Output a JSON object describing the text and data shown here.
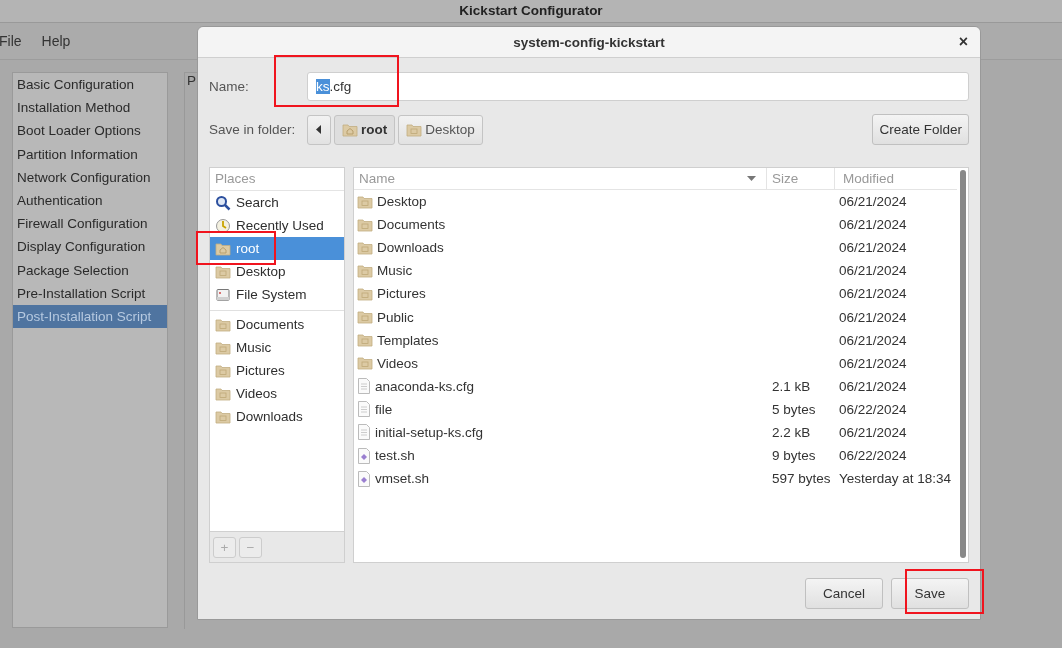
{
  "window": {
    "title": "Kickstart Configurator"
  },
  "menu": [
    "File",
    "Help"
  ],
  "sidebar": {
    "items": [
      {
        "label": "Basic Configuration",
        "selected": false
      },
      {
        "label": "Installation Method",
        "selected": false
      },
      {
        "label": "Boot Loader Options",
        "selected": false
      },
      {
        "label": "Partition Information",
        "selected": false
      },
      {
        "label": "Network Configuration",
        "selected": false
      },
      {
        "label": "Authentication",
        "selected": false
      },
      {
        "label": "Firewall Configuration",
        "selected": false
      },
      {
        "label": "Display Configuration",
        "selected": false
      },
      {
        "label": "Package Selection",
        "selected": false
      },
      {
        "label": "Pre-Installation Script",
        "selected": false
      },
      {
        "label": "Post-Installation Script",
        "selected": true
      }
    ]
  },
  "panel_fragment": "P",
  "dialog": {
    "title": "system-config-kickstart",
    "close": "×",
    "name_label": "Name:",
    "name_field": {
      "highlighted": true,
      "value": [
        {
          "text": "ks",
          "selected": true
        },
        {
          "text": ".cfg",
          "selected": false
        }
      ]
    },
    "folder_label": "Save in folder:",
    "path": [
      {
        "label": "root",
        "kind": "home",
        "selected": true
      },
      {
        "label": "Desktop",
        "kind": "folder",
        "selected": false
      }
    ],
    "create_folder": "Create Folder",
    "places": {
      "header": "Places",
      "sections": [
        [
          {
            "label": "Search",
            "kind": "search",
            "selected": false,
            "highlighted": false
          },
          {
            "label": "Recently Used",
            "kind": "recent",
            "selected": false,
            "highlighted": false
          },
          {
            "label": "root",
            "kind": "home",
            "selected": true,
            "highlighted": true
          },
          {
            "label": "Desktop",
            "kind": "folder",
            "selected": false,
            "highlighted": false
          },
          {
            "label": "File System",
            "kind": "drive",
            "selected": false,
            "highlighted": false
          }
        ],
        [
          {
            "label": "Documents",
            "kind": "folder",
            "selected": false,
            "highlighted": false
          },
          {
            "label": "Music",
            "kind": "folder",
            "selected": false,
            "highlighted": false
          },
          {
            "label": "Pictures",
            "kind": "folder",
            "selected": false,
            "highlighted": false
          },
          {
            "label": "Videos",
            "kind": "folder",
            "selected": false,
            "highlighted": false
          },
          {
            "label": "Downloads",
            "kind": "folder",
            "selected": false,
            "highlighted": false
          }
        ]
      ],
      "add": "+",
      "remove": "−"
    },
    "files": {
      "columns": [
        "Name",
        "Size",
        "Modified"
      ],
      "rows": [
        {
          "name": "Desktop",
          "kind": "folder",
          "size": "",
          "modified": "06/21/2024"
        },
        {
          "name": "Documents",
          "kind": "folder",
          "size": "",
          "modified": "06/21/2024"
        },
        {
          "name": "Downloads",
          "kind": "folder",
          "size": "",
          "modified": "06/21/2024"
        },
        {
          "name": "Music",
          "kind": "folder",
          "size": "",
          "modified": "06/21/2024"
        },
        {
          "name": "Pictures",
          "kind": "folder",
          "size": "",
          "modified": "06/21/2024"
        },
        {
          "name": "Public",
          "kind": "folder",
          "size": "",
          "modified": "06/21/2024"
        },
        {
          "name": "Templates",
          "kind": "folder",
          "size": "",
          "modified": "06/21/2024"
        },
        {
          "name": "Videos",
          "kind": "folder",
          "size": "",
          "modified": "06/21/2024"
        },
        {
          "name": "anaconda-ks.cfg",
          "kind": "document",
          "size": "2.1 kB",
          "modified": "06/21/2024"
        },
        {
          "name": "file",
          "kind": "document",
          "size": "5 bytes",
          "modified": "06/22/2024"
        },
        {
          "name": "initial-setup-ks.cfg",
          "kind": "document",
          "size": "2.2 kB",
          "modified": "06/21/2024"
        },
        {
          "name": "test.sh",
          "kind": "script",
          "size": "9 bytes",
          "modified": "06/22/2024"
        },
        {
          "name": "vmset.sh",
          "kind": "script",
          "size": "597 bytes",
          "modified": "Yesterday at 18:34"
        }
      ]
    },
    "buttons": [
      {
        "label": "Cancel",
        "highlighted": false
      },
      {
        "label": "Save",
        "highlighted": true
      }
    ]
  }
}
